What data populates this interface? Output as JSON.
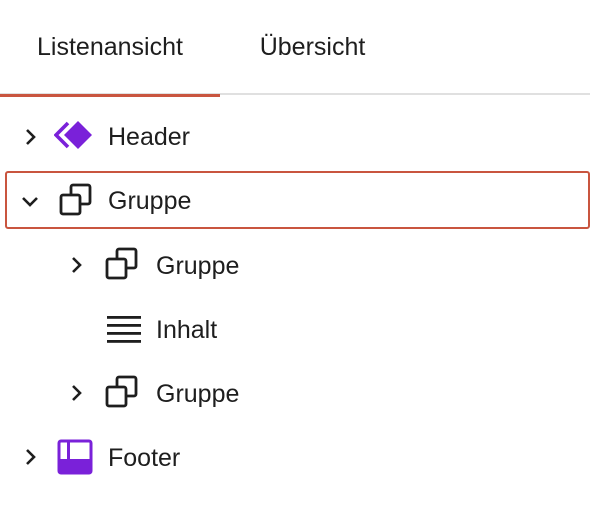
{
  "tabs": [
    {
      "label": "Listenansicht",
      "active": true
    },
    {
      "label": "Übersicht",
      "active": false
    }
  ],
  "tree": [
    {
      "label": "Header",
      "icon": "template-part-header-icon",
      "expander": "chevron-right-icon"
    },
    {
      "label": "Gruppe",
      "icon": "group-icon",
      "expander": "chevron-down-icon",
      "selected": true
    },
    {
      "label": "Gruppe",
      "icon": "group-icon",
      "expander": "chevron-right-icon"
    },
    {
      "label": "Inhalt",
      "icon": "post-content-icon"
    },
    {
      "label": "Gruppe",
      "icon": "group-icon",
      "expander": "chevron-right-icon"
    },
    {
      "label": "Footer",
      "icon": "template-part-footer-icon",
      "expander": "chevron-right-icon"
    }
  ],
  "colors": {
    "accent": "#c9553f",
    "template_part": "#7a21d9",
    "text": "#1e1e1e"
  }
}
